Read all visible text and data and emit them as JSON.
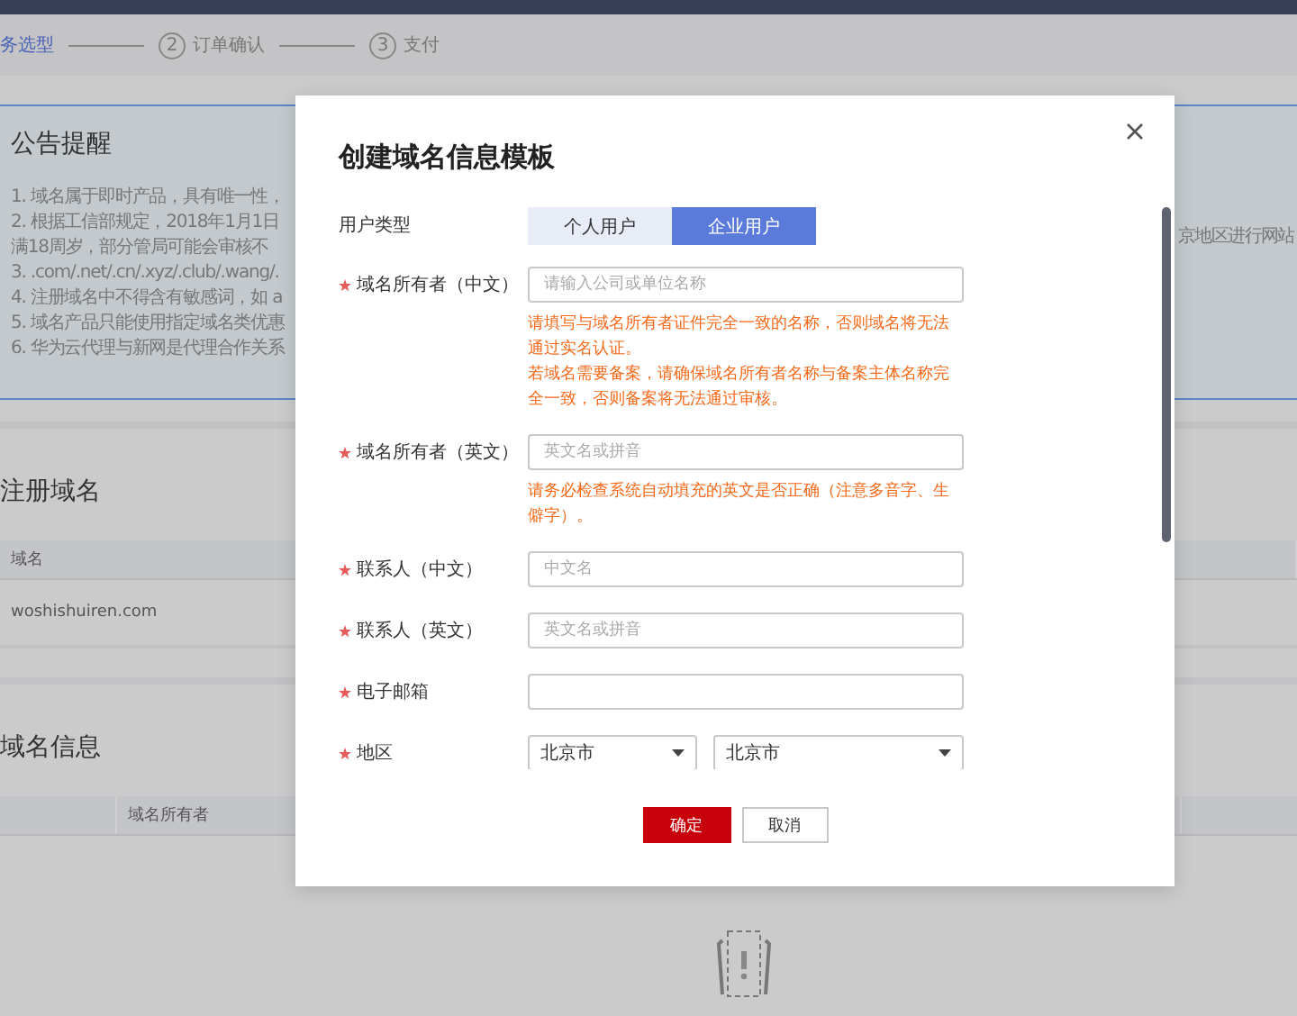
{
  "steps": [
    {
      "label": "务选型",
      "selected": true
    },
    {
      "number": "2",
      "label": "订单确认",
      "selected": false
    },
    {
      "number": "3",
      "label": "支付",
      "selected": false
    }
  ],
  "notice": {
    "title": "公告提醒",
    "lines": [
      "1. 域名属于即时产品，具有唯一性，",
      "2. 根据工信部规定，2018年1月1日",
      "满18周岁，部分管局可能会审核不",
      "3. .com/.net/.cn/.xyz/.club/.wang/.",
      "4. 注册域名中不得含有敏感词，如 a",
      "5. 域名产品只能使用指定域名类优惠",
      "6. 华为云代理与新网是代理合作关系"
    ],
    "tail": "京地区进行网站"
  },
  "registered": {
    "title": "注册域名",
    "columns": [
      "域名"
    ],
    "rows": [
      [
        "woshishuiren.com"
      ]
    ]
  },
  "info": {
    "title": "域名信息",
    "columns": [
      "",
      "域名所有者"
    ]
  },
  "dialog": {
    "title": "创建域名信息模板",
    "user_type": {
      "label": "用户类型",
      "options": [
        {
          "label": "个人用户",
          "selected": false
        },
        {
          "label": "企业用户",
          "selected": true
        }
      ]
    },
    "fields": [
      {
        "kind": "input",
        "required": true,
        "label": "域名所有者（中文）",
        "placeholder": "请输入公司或单位名称",
        "hints": [
          "请填写与域名所有者证件完全一致的名称，否则域名将无法通过实名认证。",
          "若域名需要备案，请确保域名所有者名称与备案主体名称完全一致，否则备案将无法通过审核。"
        ]
      },
      {
        "kind": "input",
        "required": true,
        "label": "域名所有者（英文）",
        "placeholder": "英文名或拼音",
        "hints": [
          "请务必检查系统自动填充的英文是否正确（注意多音字、生僻字）。"
        ]
      },
      {
        "kind": "input",
        "required": true,
        "label": "联系人（中文）",
        "placeholder": "中文名"
      },
      {
        "kind": "input",
        "required": true,
        "label": "联系人（英文）",
        "placeholder": "英文名或拼音"
      },
      {
        "kind": "input",
        "required": true,
        "label": "电子邮箱"
      },
      {
        "kind": "select",
        "required": true,
        "label": "地区",
        "values": [
          "北京市",
          "北京市"
        ]
      }
    ],
    "buttons": [
      {
        "label": "确定",
        "kind": "primary"
      },
      {
        "label": "取消",
        "kind": "default"
      }
    ]
  }
}
